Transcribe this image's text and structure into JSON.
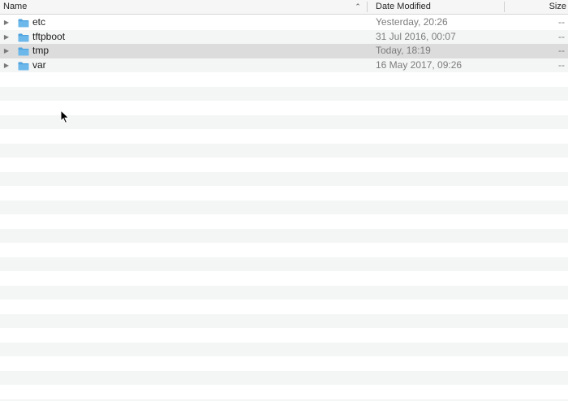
{
  "columns": {
    "name": "Name",
    "date_modified": "Date Modified",
    "size": "Size"
  },
  "sort": {
    "column": "Name",
    "direction": "ascending",
    "indicator": "⌃"
  },
  "icons": {
    "disclosure": "disclosure-triangle-icon",
    "folder": "folder-icon",
    "folder_color": "#6cb8ea",
    "folder_tab_color": "#4fa3de"
  },
  "items": [
    {
      "name": "etc",
      "date": "Yesterday, 20:26",
      "size": "--",
      "selected": false
    },
    {
      "name": "tftpboot",
      "date": "31 Jul 2016, 00:07",
      "size": "--",
      "selected": false
    },
    {
      "name": "tmp",
      "date": "Today, 18:19",
      "size": "--",
      "selected": true
    },
    {
      "name": "var",
      "date": "16 May 2017, 09:26",
      "size": "--",
      "selected": false
    }
  ],
  "disclosure_glyph": "▶"
}
